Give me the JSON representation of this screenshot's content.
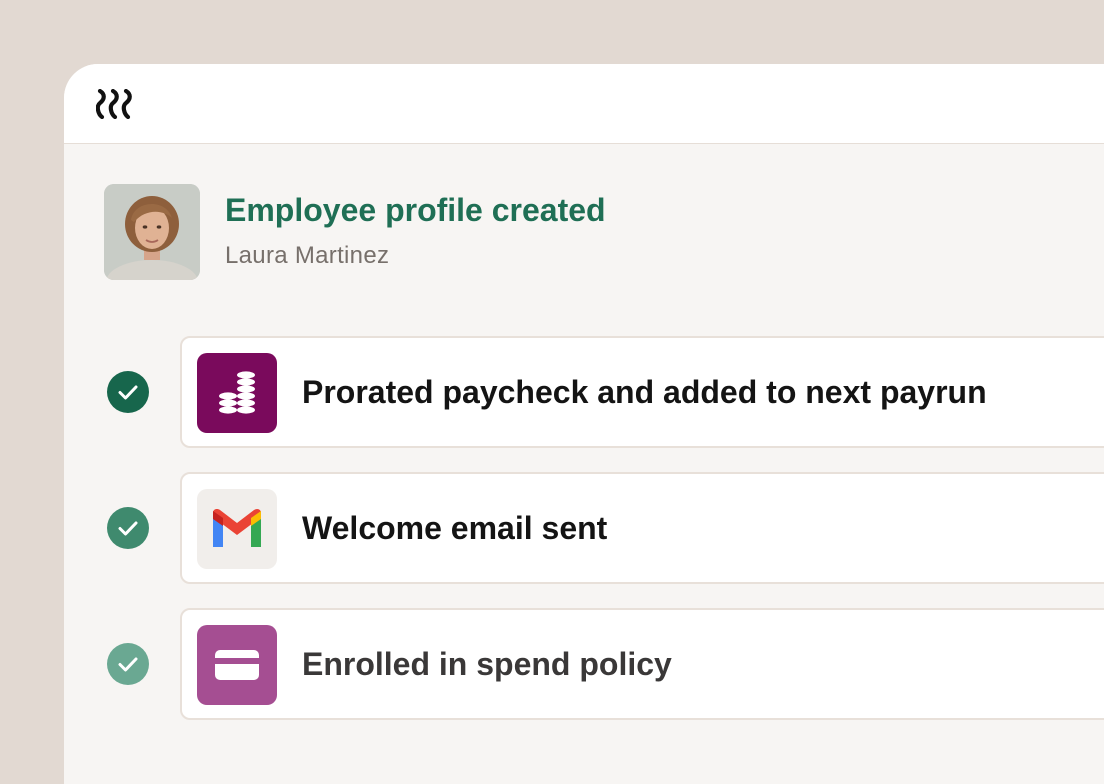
{
  "app": {
    "logo": "rippling-logo-icon"
  },
  "profile": {
    "title": "Employee profile created",
    "name": "Laura Martinez",
    "avatar": "employee-photo"
  },
  "tasks": [
    {
      "label": "Prorated paycheck and added to next payrun",
      "icon": "payroll-coins-icon",
      "icon_bg": "#7a0a5c",
      "check_color": "#17664c",
      "status": "completed"
    },
    {
      "label": "Welcome email sent",
      "icon": "gmail-icon",
      "icon_bg": "#f1eeeb",
      "check_color": "#3f8a6e",
      "status": "completed"
    },
    {
      "label": "Enrolled in spend policy",
      "icon": "credit-card-icon",
      "icon_bg": "#a54e92",
      "check_color": "#6aa892",
      "status": "completed"
    }
  ],
  "colors": {
    "background": "#e2d9d2",
    "panel": "#f7f5f3",
    "title_green": "#1f6f55",
    "subtitle_gray": "#77706b"
  }
}
